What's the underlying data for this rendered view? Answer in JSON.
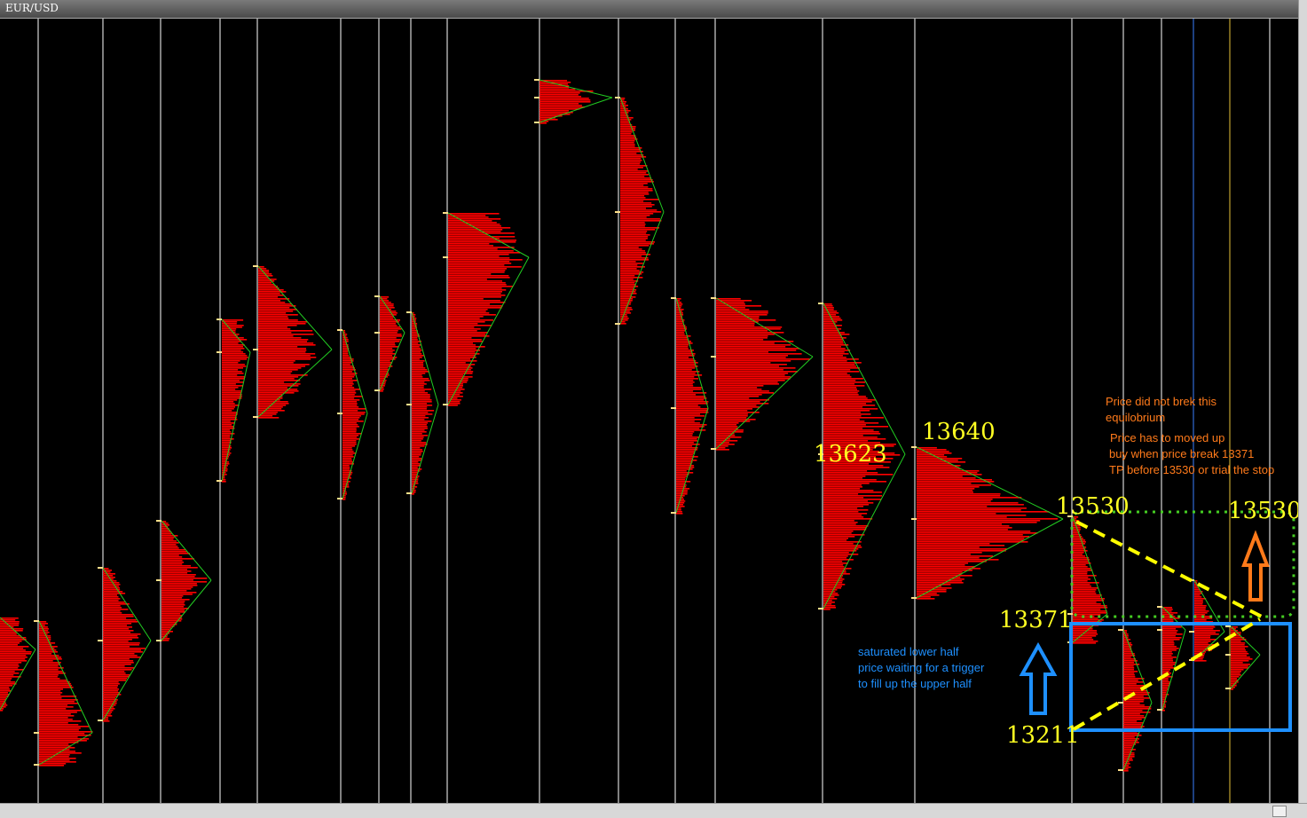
{
  "window": {
    "title": "EUR/USD"
  },
  "colors": {
    "background": "#000000",
    "separator": "#ffffff",
    "profile": "#ff0000",
    "profile_line": "#22cc22",
    "price_label": "#ffff22",
    "note_orange": "#ff7a1a",
    "note_blue": "#1e90ff",
    "box_blue": "#1e90ff",
    "dotted_green": "#44cc22",
    "arrow_orange": "#ff7a1a",
    "dashed_yellow": "#ffff00"
  },
  "chart_data": {
    "type": "market-profile",
    "symbol": "EUR/USD",
    "price_labels": [
      "13623",
      "13640",
      "13530",
      "13530",
      "13371",
      "13211"
    ],
    "annotations": {
      "top_right": [
        "Price did not brek this",
        "equilobrium",
        "Price has to moved up",
        "buy when  price break 13371",
        "TP before 13530 or trial the stop"
      ],
      "bottom_left": [
        "saturated lower half",
        "price waiting for a trigger",
        "to fill up the upper half"
      ]
    }
  }
}
